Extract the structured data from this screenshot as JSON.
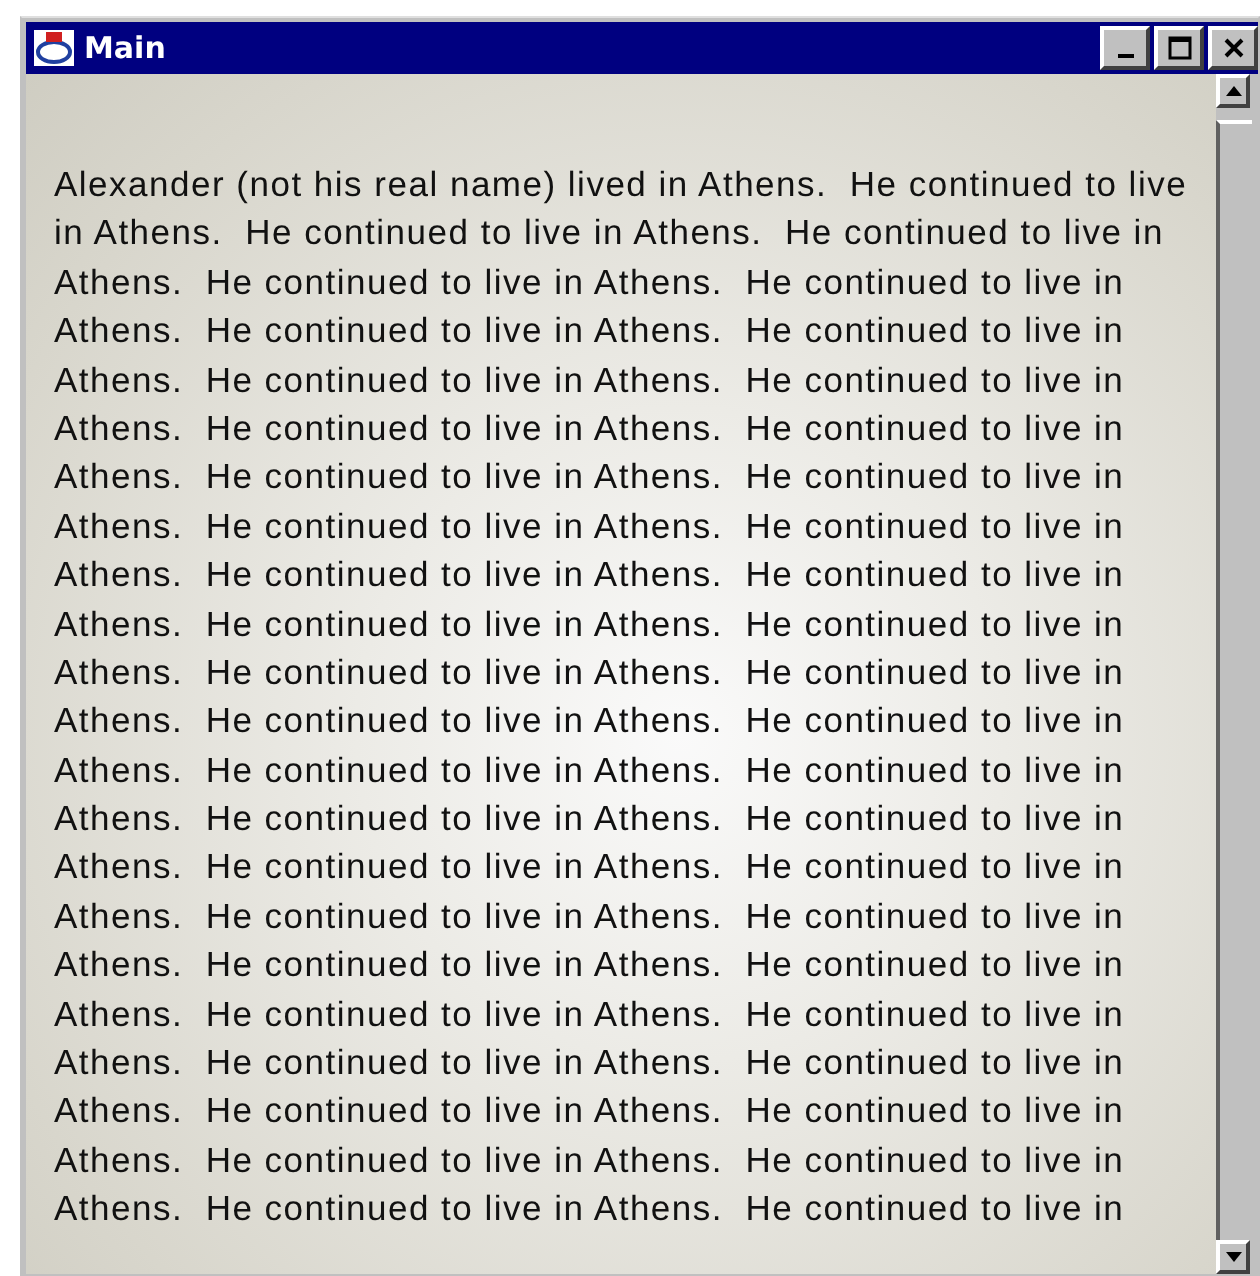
{
  "window": {
    "title": "Main"
  },
  "lines": [
    "Alexander (not his real name) lived in Athens.  He continued to live",
    "in Athens.  He continued to live in Athens.  He continued to live in",
    "Athens.  He continued to live in Athens.  He continued to live in",
    "Athens.  He continued to live in Athens.  He continued to live in",
    "Athens.  He continued to live in Athens.  He continued to live in",
    "Athens.  He continued to live in Athens.  He continued to live in",
    "Athens.  He continued to live in Athens.  He continued to live in",
    "Athens.  He continued to live in Athens.  He continued to live in",
    "Athens.  He continued to live in Athens.  He continued to live in",
    "Athens.  He continued to live in Athens.  He continued to live in",
    "Athens.  He continued to live in Athens.  He continued to live in",
    "Athens.  He continued to live in Athens.  He continued to live in",
    "Athens.  He continued to live in Athens.  He continued to live in",
    "Athens.  He continued to live in Athens.  He continued to live in",
    "Athens.  He continued to live in Athens.  He continued to live in",
    "Athens.  He continued to live in Athens.  He continued to live in",
    "Athens.  He continued to live in Athens.  He continued to live in",
    "Athens.  He continued to live in Athens.  He continued to live in",
    "Athens.  He continued to live in Athens.  He continued to live in",
    "Athens.  He continued to live in Athens.  He continued to live in",
    "Athens.  He continued to live in Athens.  He continued to live in",
    "Athens.  He continued to live in Athens.  He continued to live in"
  ]
}
